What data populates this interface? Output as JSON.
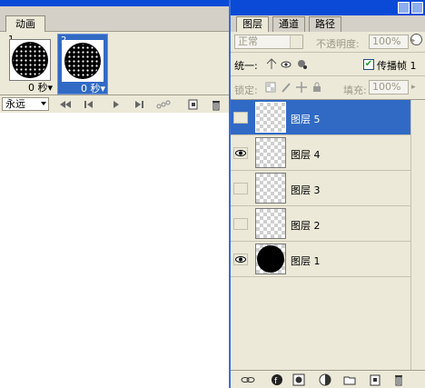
{
  "animation": {
    "tab_label": "动画",
    "frames": [
      {
        "number": "1",
        "delay": "0 秒",
        "selected": false
      },
      {
        "number": "2",
        "delay": "0 秒",
        "selected": true
      }
    ],
    "loop_option": "永远",
    "controls": [
      "first-frame-icon",
      "prev-frame-icon",
      "play-icon",
      "next-frame-icon",
      "tween-icon",
      "new-frame-icon",
      "trash-icon"
    ]
  },
  "layers_panel": {
    "tabs": [
      "图层",
      "通道",
      "路径"
    ],
    "active_tab": "图层",
    "blend_mode": "正常",
    "opacity_label": "不透明度:",
    "opacity_value": "100%",
    "unify_label": "统一:",
    "propagate_label": "传播帧 1",
    "propagate_checked": true,
    "lock_label": "锁定:",
    "fill_label": "填充:",
    "fill_value": "100%",
    "layers": [
      {
        "name": "图层 5",
        "visible": false,
        "selected": true,
        "content": "empty"
      },
      {
        "name": "图层 4",
        "visible": true,
        "selected": false,
        "content": "empty"
      },
      {
        "name": "图层 3",
        "visible": false,
        "selected": false,
        "content": "empty"
      },
      {
        "name": "图层 2",
        "visible": false,
        "selected": false,
        "content": "empty"
      },
      {
        "name": "图层 1",
        "visible": true,
        "selected": false,
        "content": "black-circle"
      }
    ]
  },
  "colors": {
    "selection": "#316ac5",
    "titlebar": "#0a4ad6",
    "panel_bg": "#ece9d8"
  }
}
